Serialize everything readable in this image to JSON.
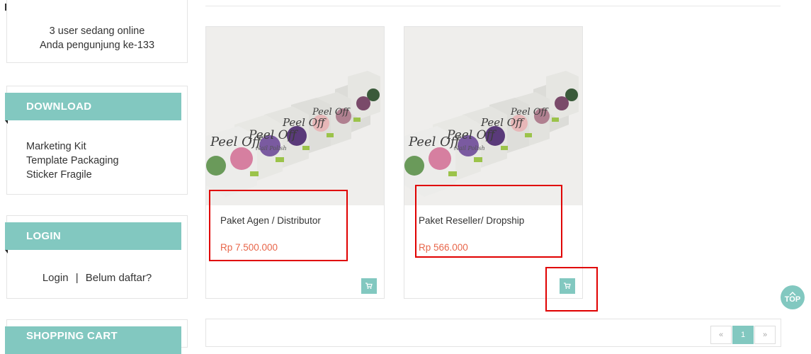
{
  "colors": {
    "accent": "#82c8c0",
    "price": "#e8664a",
    "highlight": "#e00000"
  },
  "online": {
    "users_online": "3 user sedang online",
    "visitor_count": "Anda pengunjung ke-133"
  },
  "download": {
    "title": "DOWNLOAD",
    "items": [
      {
        "label": "Marketing Kit"
      },
      {
        "label": "Template Packaging"
      },
      {
        "label": "Sticker Fragile"
      }
    ]
  },
  "login": {
    "title": "LOGIN",
    "login_link": "Login",
    "separator": "|",
    "register_link": "Belum daftar?"
  },
  "shopping_cart": {
    "title": "SHOPPING CART"
  },
  "products": [
    {
      "name": "Paket Agen / Distributor",
      "price": "Rp 7.500.000",
      "cart_icon": "cart-icon"
    },
    {
      "name": "Paket Reseller/ Dropship",
      "price": "Rp 566.000",
      "cart_icon": "cart-icon"
    }
  ],
  "product_image_text": {
    "brand": "Peel Off",
    "sub": "Nail Polish"
  },
  "pagination": {
    "prev": "«",
    "current": "1",
    "next": "»"
  },
  "back_to_top": {
    "label": "TOP",
    "icon": "chevron-up-icon"
  }
}
